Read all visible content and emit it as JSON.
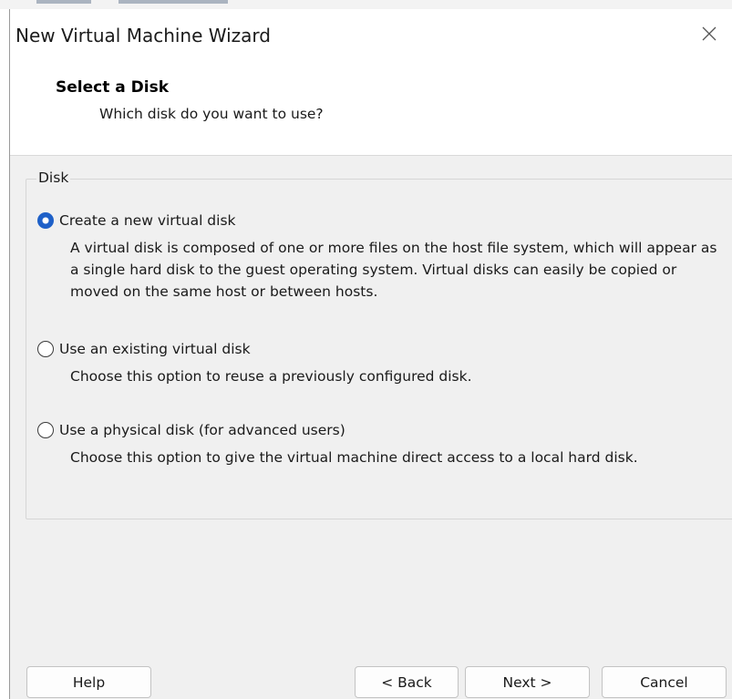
{
  "window": {
    "title": "New Virtual Machine Wizard"
  },
  "header": {
    "title": "Select a Disk",
    "subtitle": "Which disk do you want to use?"
  },
  "group": {
    "legend": "Disk",
    "options": [
      {
        "label": "Create a new virtual disk",
        "description": "A virtual disk is composed of one or more files on the host file system, which will appear as a single hard disk to the guest operating system. Virtual disks can easily be copied or moved on the same host or between hosts.",
        "checked": true
      },
      {
        "label": "Use an existing virtual disk",
        "description": "Choose this option to reuse a previously configured disk.",
        "checked": false
      },
      {
        "label": "Use a physical disk (for advanced users)",
        "description": "Choose this option to give the virtual machine direct access to a local hard disk.",
        "checked": false
      }
    ]
  },
  "buttons": {
    "help": "Help",
    "back": "< Back",
    "next": "Next >",
    "cancel": "Cancel"
  },
  "icons": {
    "close": "close-icon",
    "radio_selected": "radio-checked",
    "radio_unselected": "radio-unchecked"
  },
  "colors": {
    "radio_accent": "#1e60c8",
    "window_background": "#f0f0f0",
    "header_background": "#ffffff"
  }
}
